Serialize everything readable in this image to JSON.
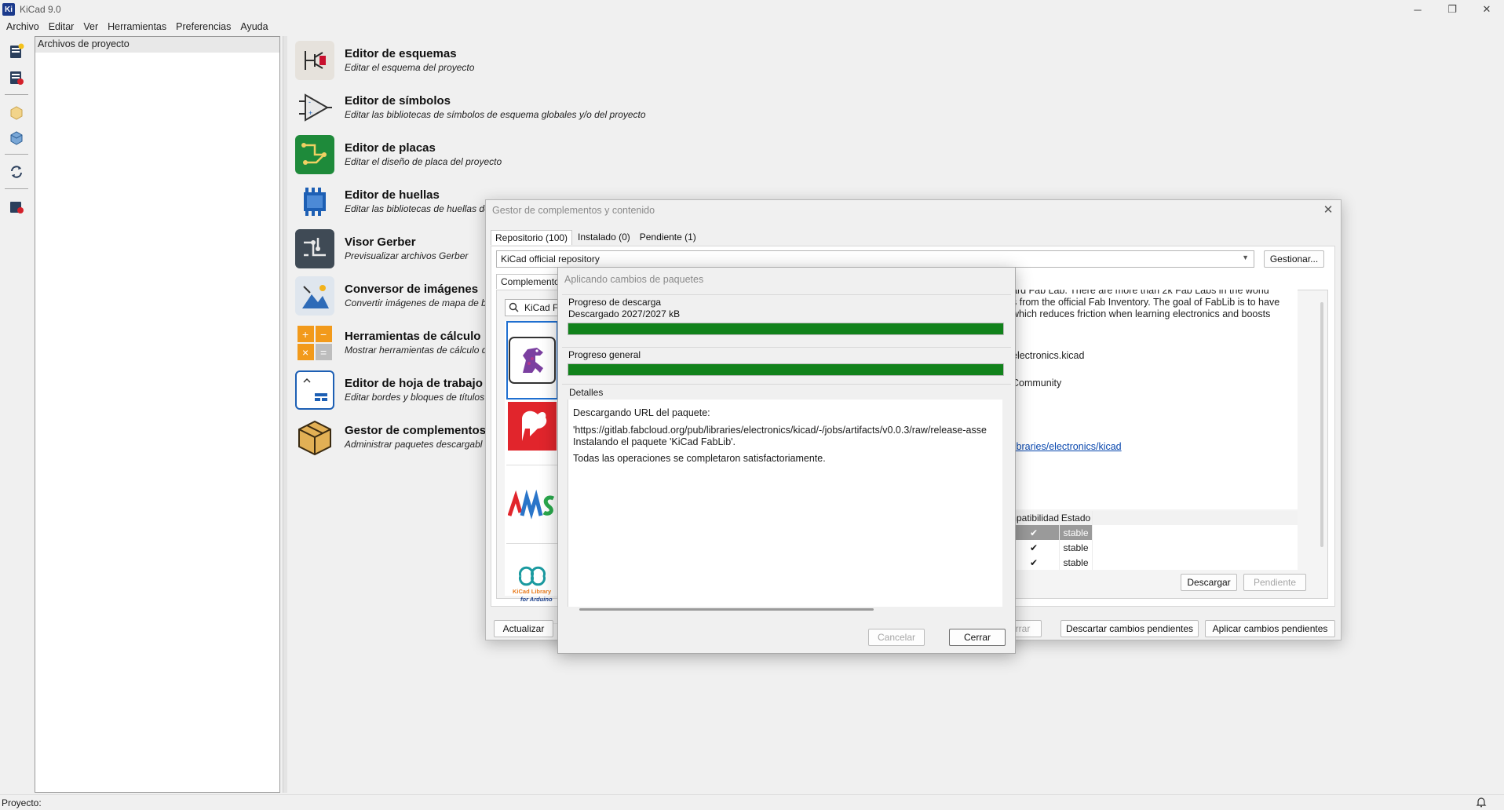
{
  "window": {
    "logo": "Ki",
    "title": "KiCad 9.0",
    "controls": {
      "minimize": "─",
      "restore": "❐",
      "close": "✕"
    }
  },
  "menu": [
    "Archivo",
    "Editar",
    "Ver",
    "Herramientas",
    "Preferencias",
    "Ayuda"
  ],
  "left_toolbar": {
    "icons": [
      "new-project-icon",
      "open-project-icon",
      "archive-icon",
      "unarchive-icon",
      "refresh-icon",
      "close-project-icon"
    ]
  },
  "project_panel": {
    "header": "Archivos de proyecto"
  },
  "launchers": [
    {
      "title": "Editor de esquemas",
      "desc": "Editar el esquema del proyecto",
      "icon": "schematic-editor-icon"
    },
    {
      "title": "Editor de símbolos",
      "desc": "Editar las bibliotecas de símbolos de esquema globales y/o del proyecto",
      "icon": "symbol-editor-icon"
    },
    {
      "title": "Editor de placas",
      "desc": "Editar el diseño de placa del proyecto",
      "icon": "pcb-editor-icon"
    },
    {
      "title": "Editor de huellas",
      "desc": "Editar las bibliotecas de huellas de",
      "icon": "footprint-editor-icon"
    },
    {
      "title": "Visor Gerber",
      "desc": "Previsualizar archivos Gerber",
      "icon": "gerber-viewer-icon"
    },
    {
      "title": "Conversor de imágenes",
      "desc": "Convertir imágenes de mapa de b",
      "icon": "image-converter-icon"
    },
    {
      "title": "Herramientas de cálculo",
      "desc": "Mostrar herramientas de cálculo d",
      "icon": "calculator-icon"
    },
    {
      "title": "Editor de hoja de trabajo",
      "desc": "Editar bordes y bloques de títulos",
      "icon": "worksheet-editor-icon"
    },
    {
      "title": "Gestor de complementos",
      "desc": "Administrar paquetes descargabl",
      "icon": "plugin-manager-icon"
    }
  ],
  "status": {
    "project_label": "Proyecto:"
  },
  "pcm": {
    "title": "Gestor de complementos y contenido",
    "tabs": [
      "Repositorio (100)",
      "Instalado (0)",
      "Pendiente (1)"
    ],
    "repository": "KiCad official repository",
    "manage_button": "Gestionar...",
    "inner_tab": "Complemento",
    "search_value": "KiCad F",
    "details_lines": [
      "ard Fab Lab. There are more than 2k Fab Labs in the world",
      "s from the official Fab Inventory. The goal of FabLib is to have",
      "which reduces friction when learning electronics and boosts",
      "",
      "",
      "",
      "electronics.kicad",
      "",
      "",
      "Community"
    ],
    "details_link": "libraries/electronics/kicad",
    "version_headers": [
      "mpatibilidad",
      "Estado"
    ],
    "versions": [
      {
        "compat": "✔",
        "state": "stable"
      },
      {
        "compat": "✔",
        "state": "stable"
      },
      {
        "compat": "✔",
        "state": "stable"
      }
    ],
    "download_button": "Descargar",
    "pending_button": "Pendiente",
    "update_button": "Actualizar",
    "close_partial": "rrar",
    "discard_button": "Descartar cambios pendientes",
    "apply_button": "Aplicar cambios pendientes"
  },
  "progress": {
    "title": "Aplicando cambios de paquetes",
    "download_label": "Progreso de descarga",
    "download_status": "Descargado 2027/2027 kB",
    "download_fraction": 1.0,
    "overall_label": "Progreso general",
    "overall_fraction": 1.0,
    "details_label": "Detalles",
    "details": [
      "Descargando URL del paquete:",
      "'https://gitlab.fabcloud.org/pub/libraries/electronics/kicad/-/jobs/artifacts/v0.0.3/raw/release-asse",
      "Instalando el paquete 'KiCad FabLib'.",
      "Todas las operaciones se completaron satisfactoriamente."
    ],
    "cancel_button": "Cancelar",
    "close_button": "Cerrar"
  },
  "colors": {
    "progress_green": "#11821b",
    "link_blue": "#0645ad",
    "selection_gray": "#9a9a9a"
  }
}
